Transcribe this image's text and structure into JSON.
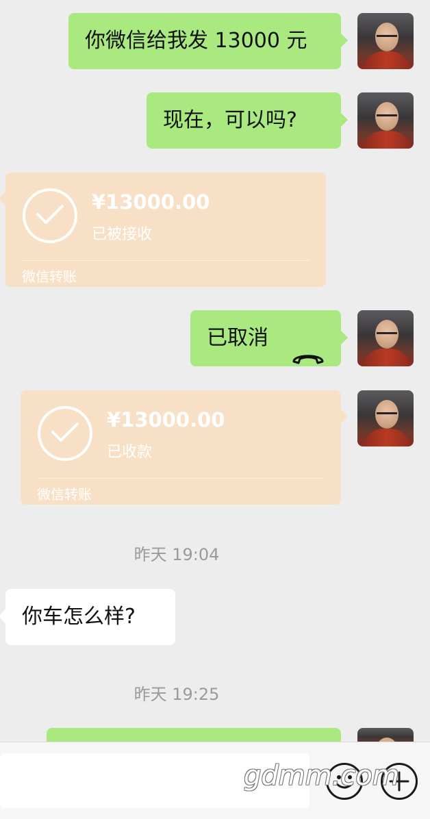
{
  "messages": {
    "m1": "你微信给我发 13000 元",
    "m2": "现在，可以吗?",
    "m3_call": "已取消",
    "m4": "你车怎么样?"
  },
  "transfers": {
    "t1": {
      "amount": "¥13000.00",
      "status": "已被接收",
      "footer": "微信转账"
    },
    "t2": {
      "amount": "¥13000.00",
      "status": "已收款",
      "footer": "微信转账"
    }
  },
  "timestamps": {
    "ts1": "昨天 19:04",
    "ts2": "昨天 19:25"
  },
  "watermark": "gdmm.com",
  "icons": {
    "call": "phone-hangup-icon",
    "emoji": "emoji-icon",
    "plus": "plus-icon",
    "check": "check-circle-icon"
  },
  "colors": {
    "green_bubble": "#a9e97f",
    "transfer_bg": "#f7e0c6",
    "background": "#ededed"
  }
}
